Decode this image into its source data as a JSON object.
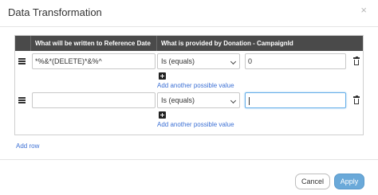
{
  "dialog": {
    "title": "Data Transformation",
    "close_glyph": "×"
  },
  "table": {
    "headers": [
      "What will be written to Reference Date",
      "What is provided by Donation - CampaignId"
    ],
    "rows": [
      {
        "reference_value": "*%&*(DELETE)*&%^",
        "operator": "Is (equals)",
        "donation_value": "0",
        "add_value_label": "Add another possible value"
      },
      {
        "reference_value": "",
        "operator": "Is (equals)",
        "donation_value": "",
        "add_value_label": "Add another possible value"
      }
    ]
  },
  "add_row_label": "Add row",
  "footer": {
    "cancel_label": "Cancel",
    "apply_label": "Apply"
  },
  "colors": {
    "header_bg": "#4a4a4a",
    "link": "#3b6fd4",
    "apply_bg": "#6aa9d9",
    "focus_border": "#66afe9"
  },
  "icons": [
    "close-icon",
    "drag-handle-icon",
    "chevron-down-icon",
    "trash-icon",
    "plus-icon"
  ]
}
